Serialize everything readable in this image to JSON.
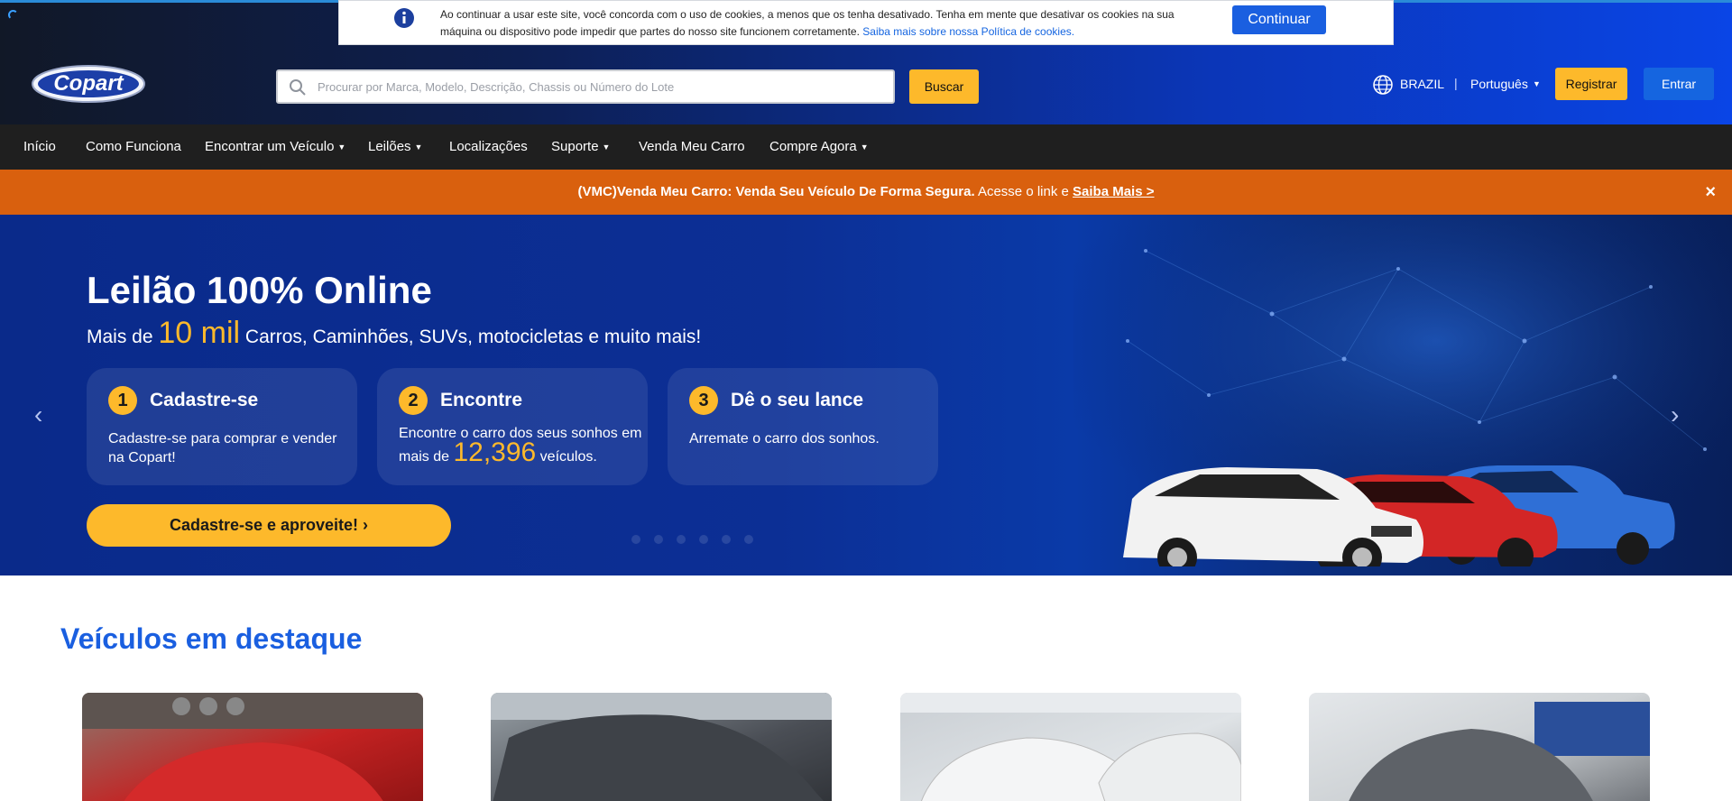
{
  "cookie": {
    "text": "Ao continuar a usar este site, você concorda com o uso de cookies, a menos que os tenha desativado. Tenha em mente que desativar os cookies na sua máquina ou dispositivo pode impedir que partes do nosso site funcionem corretamente.",
    "link": "Saiba mais sobre nossa Política de cookies.",
    "button": "Continuar"
  },
  "header": {
    "logo_text": "Copart",
    "search_placeholder": "Procurar por Marca, Modelo, Descrição, Chassis ou Número do Lote",
    "search_button": "Buscar",
    "country": "BRAZIL",
    "separator": "|",
    "language": "Português",
    "register": "Registrar",
    "login": "Entrar"
  },
  "nav": {
    "items": [
      {
        "label": "Início"
      },
      {
        "label": "Como Funciona"
      },
      {
        "label": "Encontrar um Veículo"
      },
      {
        "label": "Leilões"
      },
      {
        "label": "Localizações"
      },
      {
        "label": "Suporte"
      },
      {
        "label": "Venda Meu Carro"
      },
      {
        "label": "Compre Agora"
      }
    ]
  },
  "promo": {
    "strong": "(VMC)Venda Meu Carro: Venda Seu Veículo De Forma Segura.",
    "text": " Acesse o link e ",
    "link": "Saiba Mais >",
    "close": "×"
  },
  "hero": {
    "title": "Leilão 100% Online",
    "sub_prefix": "Mais de ",
    "sub_big": "10 mil",
    "sub_suffix": " Carros, Caminhões, SUVs, motocicletas e muito mais!",
    "steps": [
      {
        "num": "1",
        "title": "Cadastre-se",
        "text": "Cadastre-se para comprar e vender na Copart!"
      },
      {
        "num": "2",
        "title": "Encontre",
        "text_prefix": "Encontre o carro dos seus sonhos em mais de ",
        "count": "12,396",
        "text_suffix": " veículos."
      },
      {
        "num": "3",
        "title": "Dê o seu lance",
        "text": "Arremate o carro dos sonhos."
      }
    ],
    "cta": "Cadastre-se e aproveite! ›",
    "prev": "‹",
    "next": "›"
  },
  "featured": {
    "title": "Veículos em destaque"
  },
  "colors": {
    "accent_yellow": "#fdb92b",
    "primary_blue": "#1a5fe0",
    "promo_orange": "#d9600e",
    "nav_dark": "#1f1f1f"
  }
}
